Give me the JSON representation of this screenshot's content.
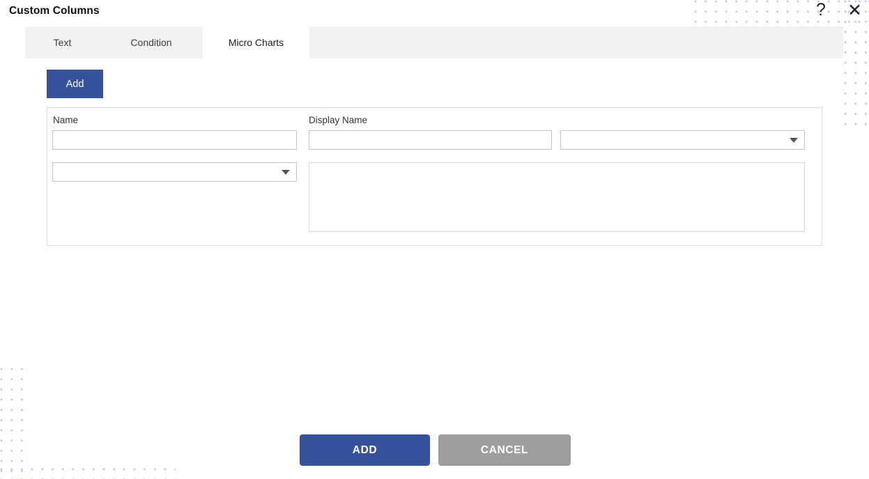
{
  "dialog": {
    "title": "Custom Columns",
    "help_icon": "question-mark-icon",
    "close_icon": "close-icon",
    "help_glyph": "?",
    "close_glyph": "✕"
  },
  "tabs": [
    {
      "label": "Text",
      "active": false
    },
    {
      "label": "Condition",
      "active": false
    },
    {
      "label": "Micro Charts",
      "active": true
    }
  ],
  "toolbar": {
    "add_label": "Add"
  },
  "form": {
    "name": {
      "label": "Name",
      "value": "",
      "placeholder": ""
    },
    "display_name": {
      "label": "Display Name",
      "value": "",
      "placeholder": ""
    },
    "chart_type_select": {
      "value": "",
      "icon": "chevron-down-icon"
    },
    "source_select": {
      "value": "",
      "icon": "chevron-down-icon"
    },
    "expression": {
      "value": "",
      "placeholder": ""
    }
  },
  "footer": {
    "add_label": "ADD",
    "cancel_label": "CANCEL"
  },
  "colors": {
    "primary": "#37529c",
    "cancel": "#9e9e9e",
    "tab_bar_bg": "#f2f2f2",
    "panel_border": "#dddddd",
    "input_border": "#bfc6d2",
    "dot_pattern": "#9aa6de"
  }
}
